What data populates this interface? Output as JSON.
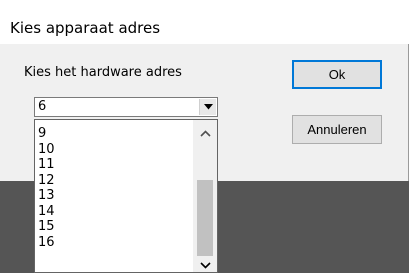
{
  "dialog": {
    "title": "Kies apparaat adres",
    "prompt": "Kies het hardware adres",
    "ok_label": "Ok",
    "cancel_label": "Annuleren"
  },
  "combo": {
    "selected_value": "6",
    "arrow_icon": "triangle-down-icon"
  },
  "dropdown": {
    "items": [
      "9",
      "10",
      "11",
      "12",
      "13",
      "14",
      "15",
      "16"
    ],
    "scroll_up_icon": "chevron-up-icon",
    "scroll_down_icon": "chevron-down-icon"
  },
  "colors": {
    "dialog_bg": "#f0f0f0",
    "titlebar_bg": "#ffffff",
    "button_bg": "#e1e1e1",
    "default_button_border": "#0078d7",
    "background_dark": "#555555",
    "background_light": "#c4c4c4"
  }
}
